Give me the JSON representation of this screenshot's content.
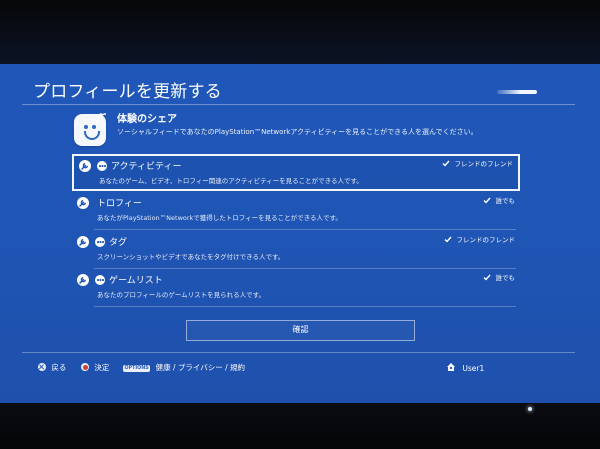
{
  "header": {
    "title": "プロフィールを更新する"
  },
  "share": {
    "title": "体験のシェア",
    "description": "ソーシャルフィードであなたのPlayStation™Networkアクティビティーを見ることができる人を選んでください。",
    "icon": "smiley-share-icon"
  },
  "settings": {
    "rows": [
      {
        "label": "アクティビティー",
        "description": "あなたのゲーム、ビデオ、トロフィー関連のアクティビティーを見ることができる人です。",
        "value": "フレンドのフレンド",
        "selected": true,
        "has_privacy_icon": true
      },
      {
        "label": "トロフィー",
        "description": "あなたがPlayStation™Networkで獲得したトロフィーを見ることができる人です。",
        "value": "誰でも",
        "selected": false,
        "has_privacy_icon": false
      },
      {
        "label": "タグ",
        "description": "スクリーンショットやビデオであなたをタグ付けできる人です。",
        "value": "フレンドのフレンド",
        "selected": false,
        "has_privacy_icon": true
      },
      {
        "label": "ゲームリスト",
        "description": "あなたのプロフィールのゲームリストを見られる人です。",
        "value": "誰でも",
        "selected": false,
        "has_privacy_icon": true
      }
    ]
  },
  "actions": {
    "confirm_label": "確認"
  },
  "footer": {
    "back_label": "戻る",
    "enter_label": "決定",
    "options_badge": "OPTIONS",
    "options_label": "健康 / プライバシー / 規約",
    "user_label": "User1"
  },
  "colors": {
    "background": "#1f56b6",
    "accent": "#ffffff",
    "button_circle": "#d33a3a"
  }
}
